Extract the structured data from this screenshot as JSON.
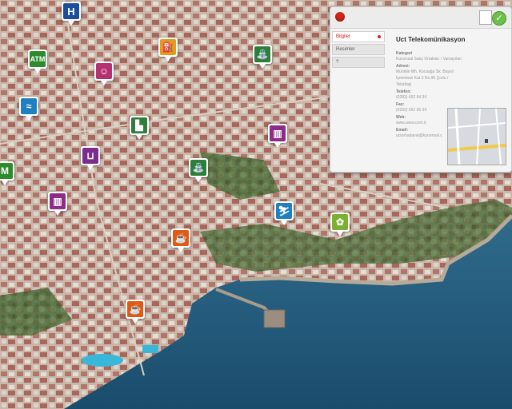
{
  "pins": [
    {
      "id": "hospital",
      "label": "H",
      "color": "#1b4f9c"
    },
    {
      "id": "atm",
      "label": "ATM",
      "color": "#2d8a2d"
    },
    {
      "id": "theater",
      "label": "",
      "color": "#b5316f"
    },
    {
      "id": "fuel",
      "label": "",
      "color": "#e59a1b"
    },
    {
      "id": "fountain",
      "label": "",
      "color": "#2e7d3a"
    },
    {
      "id": "swim",
      "label": "",
      "color": "#1e7fc2"
    },
    {
      "id": "factory",
      "label": "",
      "color": "#2e7d3a"
    },
    {
      "id": "museum",
      "label": "",
      "color": "#8d2c86"
    },
    {
      "id": "market",
      "label": "M",
      "color": "#2d8a2d"
    },
    {
      "id": "cart",
      "label": "",
      "color": "#7a2d8d"
    },
    {
      "id": "fountain2",
      "label": "",
      "color": "#2e7d3a"
    },
    {
      "id": "museum2",
      "label": "",
      "color": "#8d2c86"
    },
    {
      "id": "ski",
      "label": "",
      "color": "#1e7fc2"
    },
    {
      "id": "park",
      "label": "",
      "color": "#7bb030"
    },
    {
      "id": "cafe",
      "label": "",
      "color": "#e05a14"
    },
    {
      "id": "restaurant",
      "label": "",
      "color": "#e05a14"
    }
  ],
  "panel": {
    "tabs": [
      {
        "label": "Bilgiler",
        "active": true
      },
      {
        "label": "Resimler",
        "active": false
      },
      {
        "label": "?",
        "active": false
      }
    ],
    "title": "Uct Telekomünikasyon",
    "fields": [
      {
        "label": "Kategori",
        "value": "Kurumsal Satış Ortakları / Varsayılan"
      },
      {
        "label": "Adresi:",
        "value": "Muhittin Mh. Kocaağa Sk. Baysil İşmerkezi Kat 3 No.90 Çorlu / Tekirdağ"
      },
      {
        "label": "Telefon:",
        "value": "(0282) 652 64 34"
      },
      {
        "label": "Fax:",
        "value": "(0282) 652 65 34"
      },
      {
        "label": "Web:",
        "value": "www.avea.com.tr"
      },
      {
        "label": "Email:",
        "value": "uctorhadavai@kurumsal.c"
      }
    ]
  }
}
